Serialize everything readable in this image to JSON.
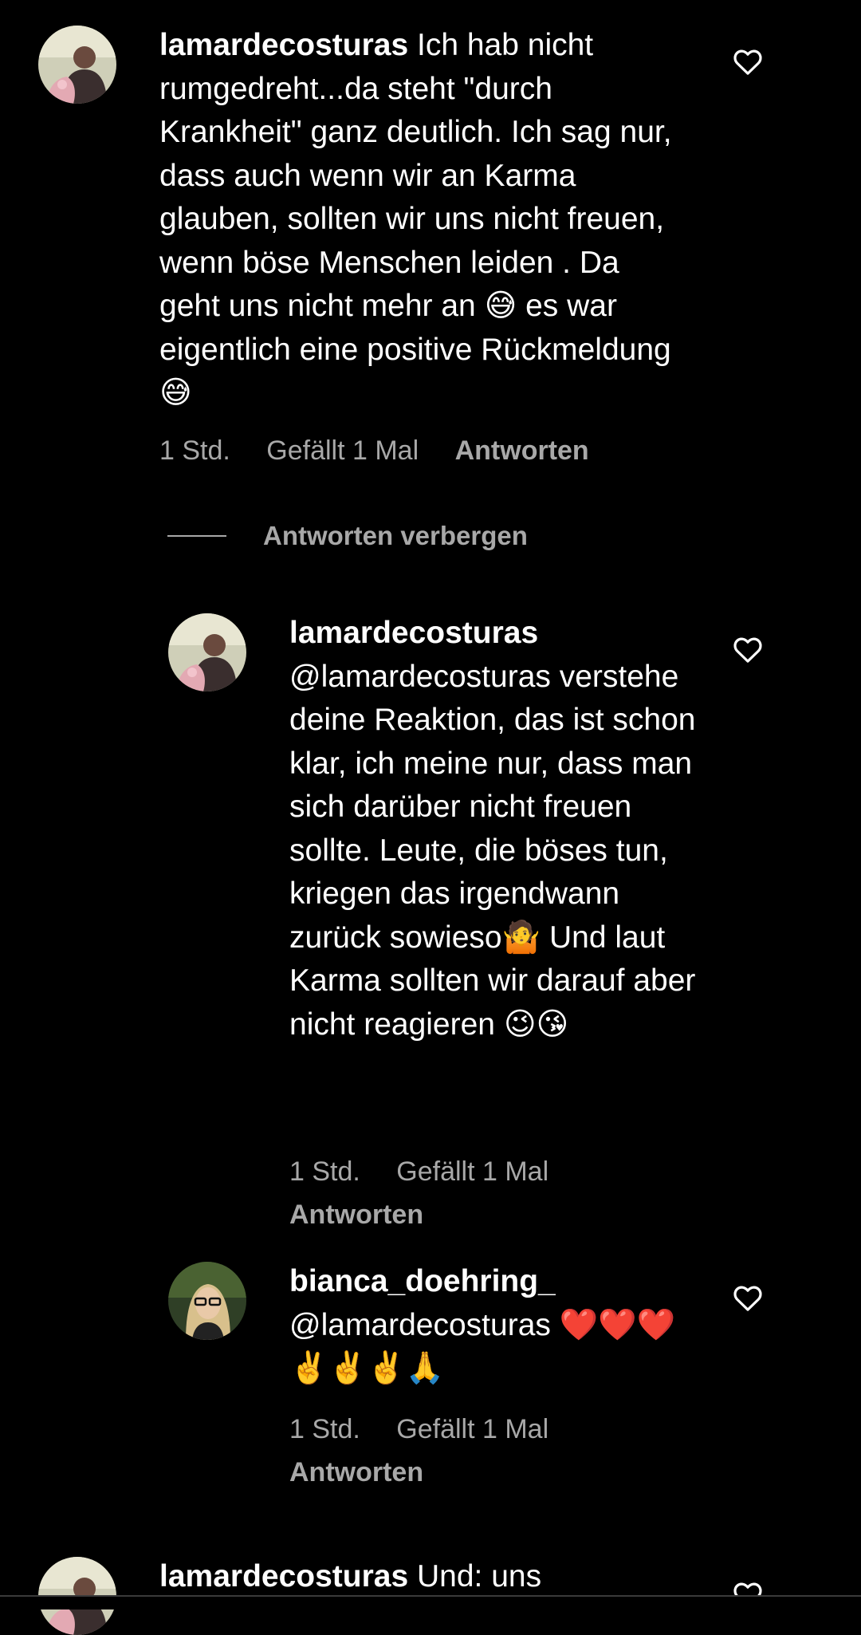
{
  "comments": [
    {
      "username": "lamardecosturas",
      "text": "Ich hab nicht rumgedreht...da steht \"durch Krankheit\" ganz deutlich. Ich sag nur, dass auch wenn wir an Karma glauben, sollten wir uns nicht freuen, wenn böse Menschen leiden . Da geht uns nicht mehr an 😅 es war eigentlich eine positive Rückmeldung😅",
      "time": "1 Std.",
      "likes": "Gefällt 1 Mal",
      "reply_label": "Antworten",
      "avatar_icon": "user-avatar-photo"
    }
  ],
  "hide_replies_label": "Antworten verbergen",
  "replies": [
    {
      "username": "lamardecosturas",
      "text": "@lamardecosturas verstehe deine Reaktion, das ist schon klar, ich meine nur, dass man sich darüber nicht freuen sollte. Leute, die böses tun, kriegen das irgendwann zurück sowieso🤷 Und laut Karma sollten wir darauf aber nicht reagieren 😉😘",
      "time": "1 Std.",
      "likes": "Gefällt 1 Mal",
      "reply_label": "Antworten",
      "avatar_icon": "user-avatar-photo"
    },
    {
      "username": "bianca_doehring_",
      "text": "@lamardecosturas ❤️❤️❤️✌️✌️✌️🙏",
      "time": "1 Std.",
      "likes": "Gefällt 1 Mal",
      "reply_label": "Antworten",
      "avatar_icon": "user-avatar-photo"
    }
  ],
  "next_comment": {
    "username": "lamardecosturas",
    "text": "Und: uns",
    "avatar_icon": "user-avatar-photo"
  },
  "icons": {
    "like": "heart-outline-icon"
  },
  "colors": {
    "background": "#000000",
    "text": "#ffffff",
    "secondary": "#a8a8a8"
  }
}
